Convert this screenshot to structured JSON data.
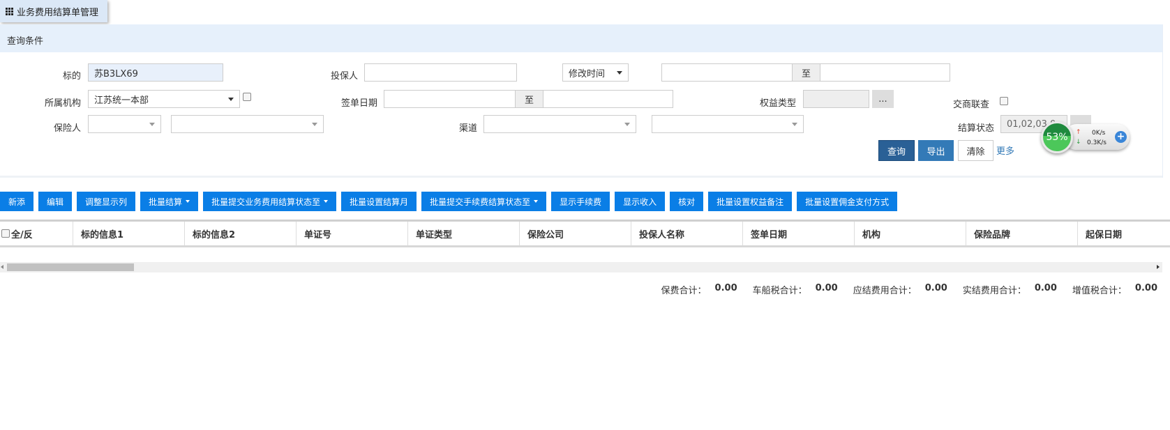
{
  "title": "业务费用结算单管理",
  "query_header": "查询条件",
  "form": {
    "subject_label": "标的",
    "subject_value": "苏B3LX69",
    "applicant_label": "投保人",
    "applicant_value": "",
    "time_type": "修改时间",
    "range_to": "至",
    "org_label": "所属机构",
    "org_value": "江苏统一本部",
    "sign_date_label": "签单日期",
    "equity_label": "权益类型",
    "equity_btn": "...",
    "cross_label": "交商联查",
    "insurer_label": "保险人",
    "channel_label": "渠道",
    "status_label": "结算状态",
    "status_value": "01,02,03,0"
  },
  "buttons": {
    "query": "查询",
    "export": "导出",
    "clear": "清除",
    "more": "更多"
  },
  "network": {
    "percent": "53%",
    "up": "0K/s",
    "down": "0.3K/s"
  },
  "toolbar": [
    {
      "label": "新添",
      "dropdown": false
    },
    {
      "label": "编辑",
      "dropdown": false
    },
    {
      "label": "调整显示列",
      "dropdown": false
    },
    {
      "label": "批量结算",
      "dropdown": true
    },
    {
      "label": "批量提交业务费用结算状态至",
      "dropdown": true
    },
    {
      "label": "批量设置结算月",
      "dropdown": false
    },
    {
      "label": "批量提交手续费结算状态至",
      "dropdown": true
    },
    {
      "label": "显示手续费",
      "dropdown": false
    },
    {
      "label": "显示收入",
      "dropdown": false
    },
    {
      "label": "核对",
      "dropdown": false
    },
    {
      "label": "批量设置权益备注",
      "dropdown": false
    },
    {
      "label": "批量设置佣金支付方式",
      "dropdown": false
    }
  ],
  "columns": [
    "全/反",
    "标的信息1",
    "标的信息2",
    "单证号",
    "单证类型",
    "保险公司",
    "投保人名称",
    "签单日期",
    "机构",
    "保险品牌",
    "起保日期"
  ],
  "totals": [
    {
      "label": "保费合计：",
      "value": "0.00"
    },
    {
      "label": "车船税合计：",
      "value": "0.00"
    },
    {
      "label": "应结费用合计：",
      "value": "0.00"
    },
    {
      "label": "实结费用合计：",
      "value": "0.00"
    },
    {
      "label": "增值税合计：",
      "value": "0.00"
    }
  ]
}
